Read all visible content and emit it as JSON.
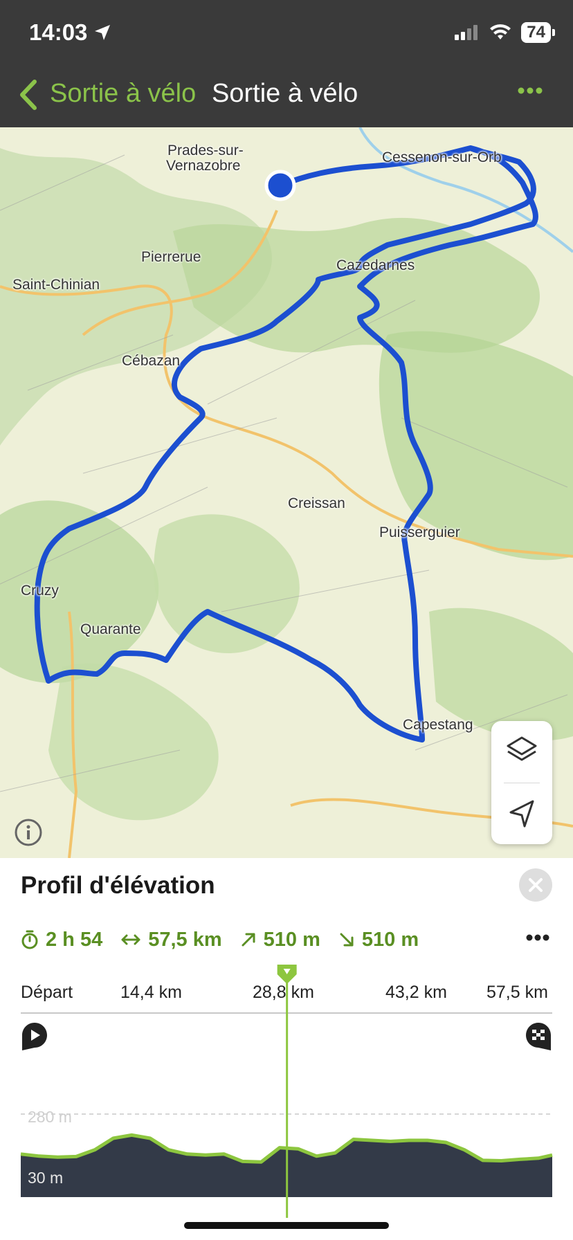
{
  "status_bar": {
    "time": "14:03",
    "battery": "74"
  },
  "header": {
    "back_label": "Sortie à vélo",
    "title": "Sortie à vélo"
  },
  "map": {
    "places": [
      "Prades-sur-",
      "Vernazobre",
      "Cessenon-sur-Orb",
      "Pierrerue",
      "Saint-Chinian",
      "Cazedarnes",
      "Cébazan",
      "Creissan",
      "Puisserguier",
      "Cruzy",
      "Quarante",
      "Capestang"
    ],
    "controls": [
      "layers-icon",
      "locate-icon"
    ]
  },
  "elevation_panel": {
    "title": "Profil d'élévation",
    "stats": {
      "duration": "2 h 54",
      "distance": "57,5 km",
      "ascent": "510 m",
      "descent": "510 m"
    },
    "chart_data": {
      "type": "area",
      "x_ticks": [
        "Départ",
        "14,4 km",
        "28,8 km",
        "43,2 km",
        "57,5 km"
      ],
      "y_ticks": [
        "280 m",
        "30 m"
      ],
      "xlabel": "",
      "ylabel": "",
      "x": [
        0,
        2,
        4,
        6,
        8,
        10,
        12,
        14,
        16,
        18,
        20,
        22,
        24,
        26,
        28,
        30,
        32,
        34,
        36,
        38,
        40,
        42,
        44,
        46,
        48,
        50,
        52,
        54,
        56,
        57.5
      ],
      "values": [
        90,
        80,
        75,
        78,
        110,
        165,
        180,
        165,
        110,
        90,
        85,
        90,
        55,
        52,
        120,
        115,
        80,
        95,
        160,
        155,
        150,
        155,
        155,
        145,
        110,
        60,
        58,
        65,
        70,
        85
      ],
      "color": "#8dc63f",
      "fill": "#333a48",
      "cursor_km": 28.8
    }
  }
}
